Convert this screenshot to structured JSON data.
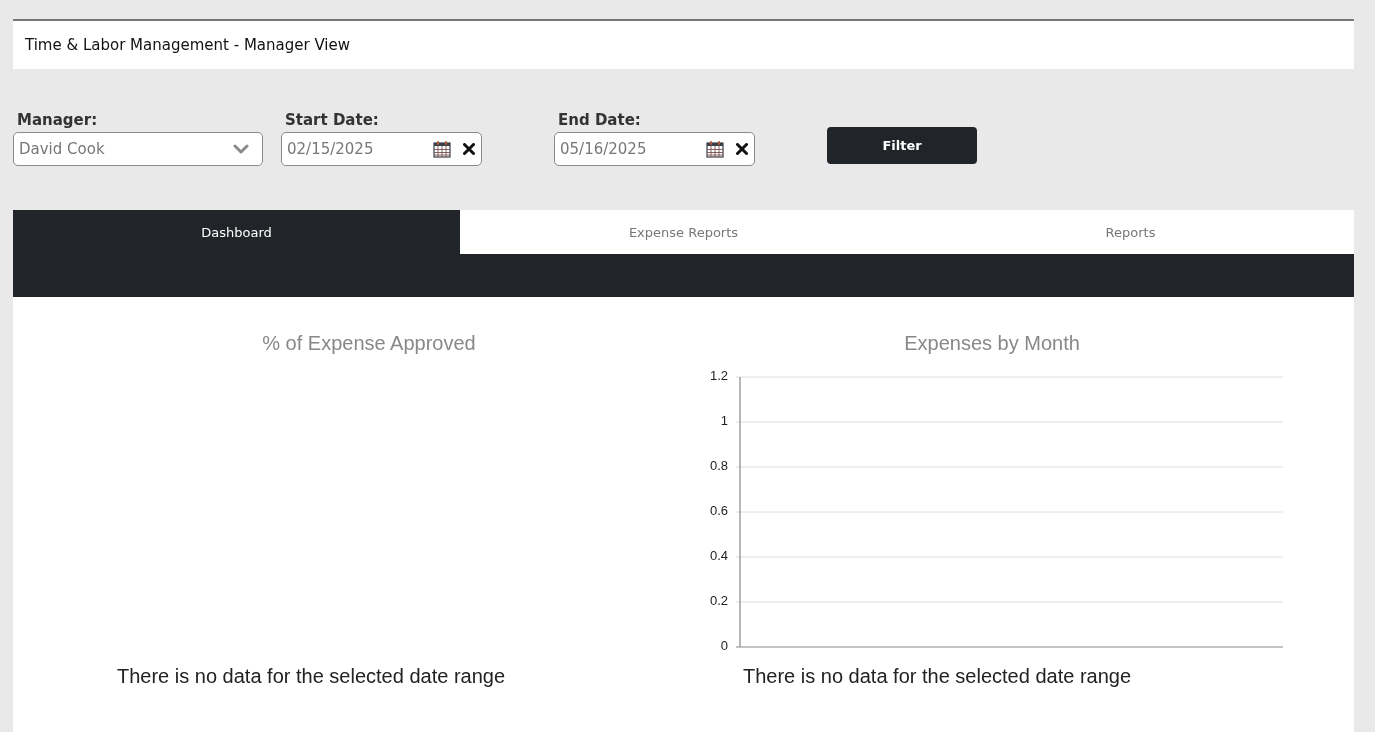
{
  "header": {
    "title": "Time & Labor Management - Manager View"
  },
  "filters": {
    "manager": {
      "label": "Manager:",
      "value": "David Cook"
    },
    "start_date": {
      "label": "Start Date:",
      "value": "02/15/2025"
    },
    "end_date": {
      "label": "End Date:",
      "value": "05/16/2025"
    },
    "button": "Filter"
  },
  "tabs": [
    {
      "label": "Dashboard",
      "selected": true
    },
    {
      "label": "Expense Reports",
      "selected": false
    },
    {
      "label": "Reports",
      "selected": false
    }
  ],
  "dashboard": {
    "approval_chart": {
      "title": "% of Expense Approved",
      "message": "There is no data for the selected date range"
    },
    "monthly_chart": {
      "chart_data": {
        "type": "bar",
        "title": "Expenses by Month",
        "categories": [
          null
        ],
        "grid": true,
        "ylim": [
          0,
          1.2
        ],
        "yticks": [
          {
            "value": 0,
            "label": "0"
          },
          {
            "value": 0.2,
            "label": "0.2"
          },
          {
            "value": 0.4,
            "label": "0.4"
          },
          {
            "value": 0.6,
            "label": "0.6"
          },
          {
            "value": 0.8,
            "label": "0.8"
          },
          {
            "value": 1,
            "label": "1"
          },
          {
            "value": 1.2,
            "label": "1.2"
          }
        ]
      },
      "message": "There is no data for the selected date range"
    }
  }
}
